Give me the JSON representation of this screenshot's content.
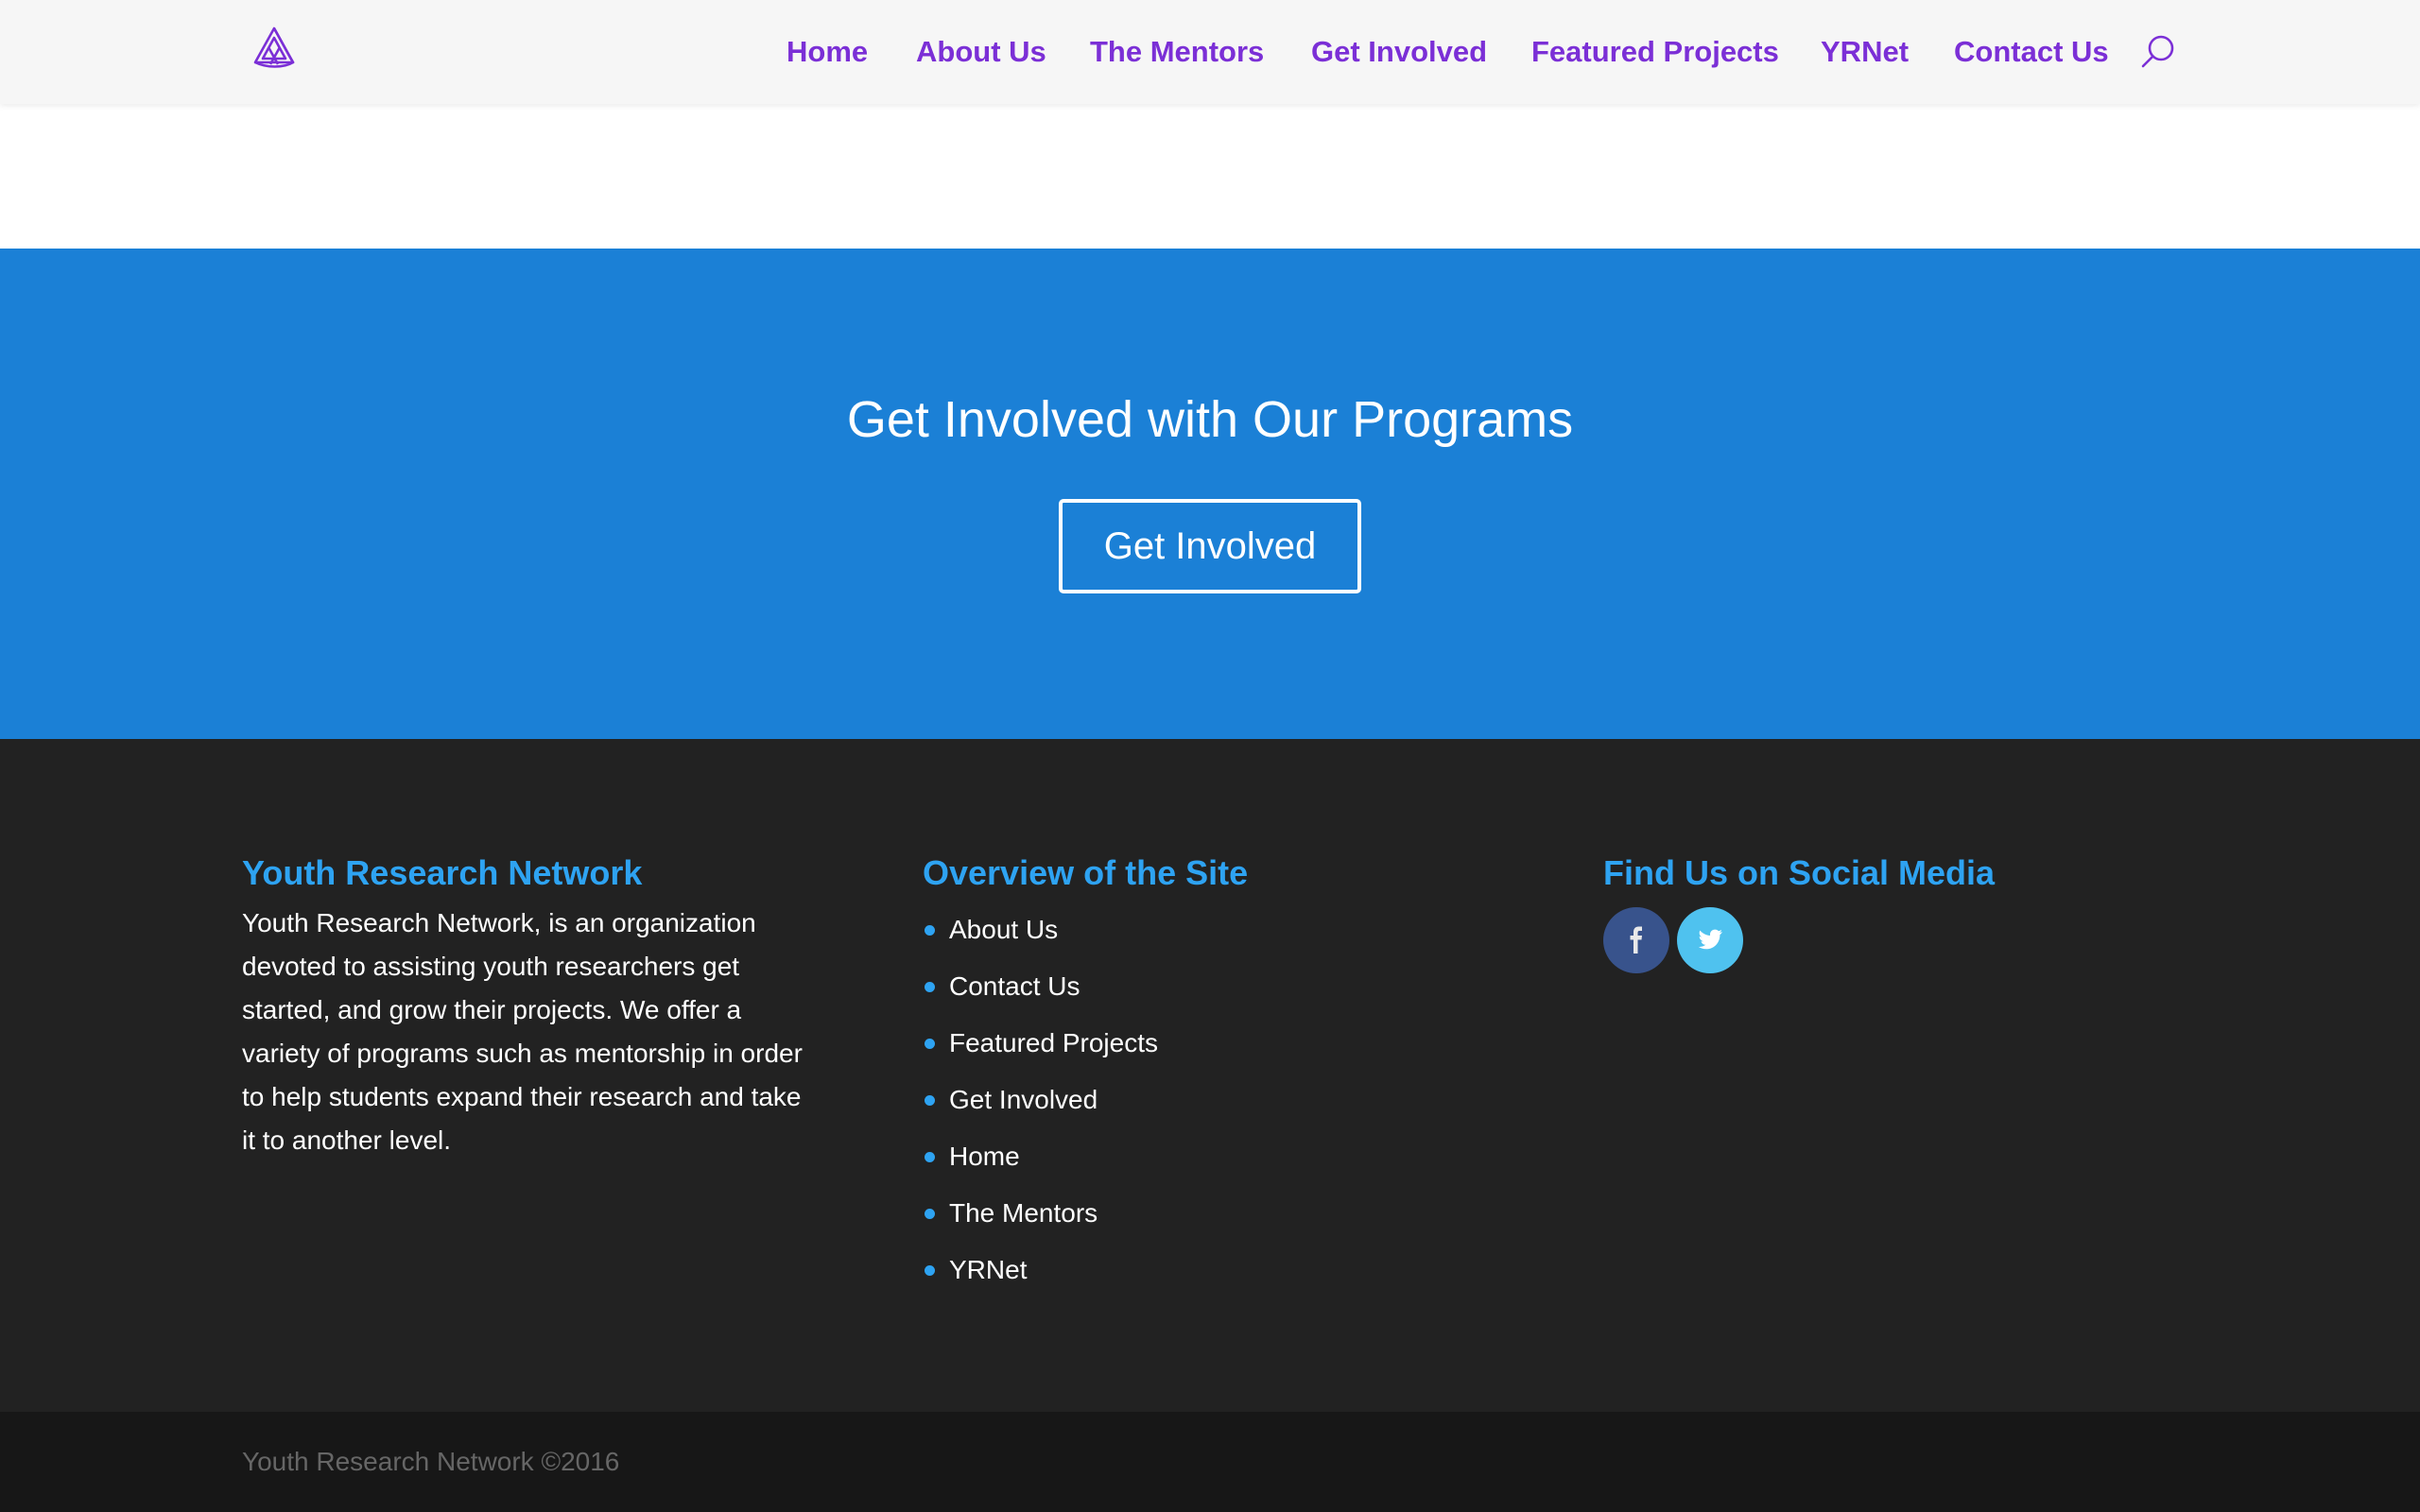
{
  "brand": {
    "logo_icon": "triquetra-knot-icon",
    "accent_color": "#7b2fd6"
  },
  "nav": {
    "items": [
      {
        "label": "Home"
      },
      {
        "label": "About Us"
      },
      {
        "label": "The Mentors"
      },
      {
        "label": "Get Involved"
      },
      {
        "label": "Featured Projects"
      },
      {
        "label": "YRNet"
      },
      {
        "label": "Contact Us"
      }
    ],
    "search_icon": "search-icon"
  },
  "banner": {
    "title": "Get Involved with Our Programs",
    "button_label": "Get Involved",
    "background_color": "#1b80d6"
  },
  "footer": {
    "about": {
      "heading": "Youth Research Network",
      "text": "Youth Research Network, is an organization devoted to assisting youth researchers get started, and grow their projects. We offer a variety of programs such as mentorship in order to help students expand their research and take it to another level."
    },
    "overview": {
      "heading": "Overview of the Site",
      "links": [
        {
          "label": "About Us"
        },
        {
          "label": "Contact Us"
        },
        {
          "label": "Featured Projects"
        },
        {
          "label": "Get Involved"
        },
        {
          "label": "Home"
        },
        {
          "label": "The Mentors"
        },
        {
          "label": "YRNet"
        }
      ]
    },
    "social": {
      "heading": "Find Us on Social Media",
      "icons": [
        "facebook-icon",
        "twitter-icon"
      ]
    },
    "heading_color": "#2ea3f2",
    "background_color": "#222222"
  },
  "bottom_bar": {
    "copyright": "Youth Research Network ©2016"
  }
}
